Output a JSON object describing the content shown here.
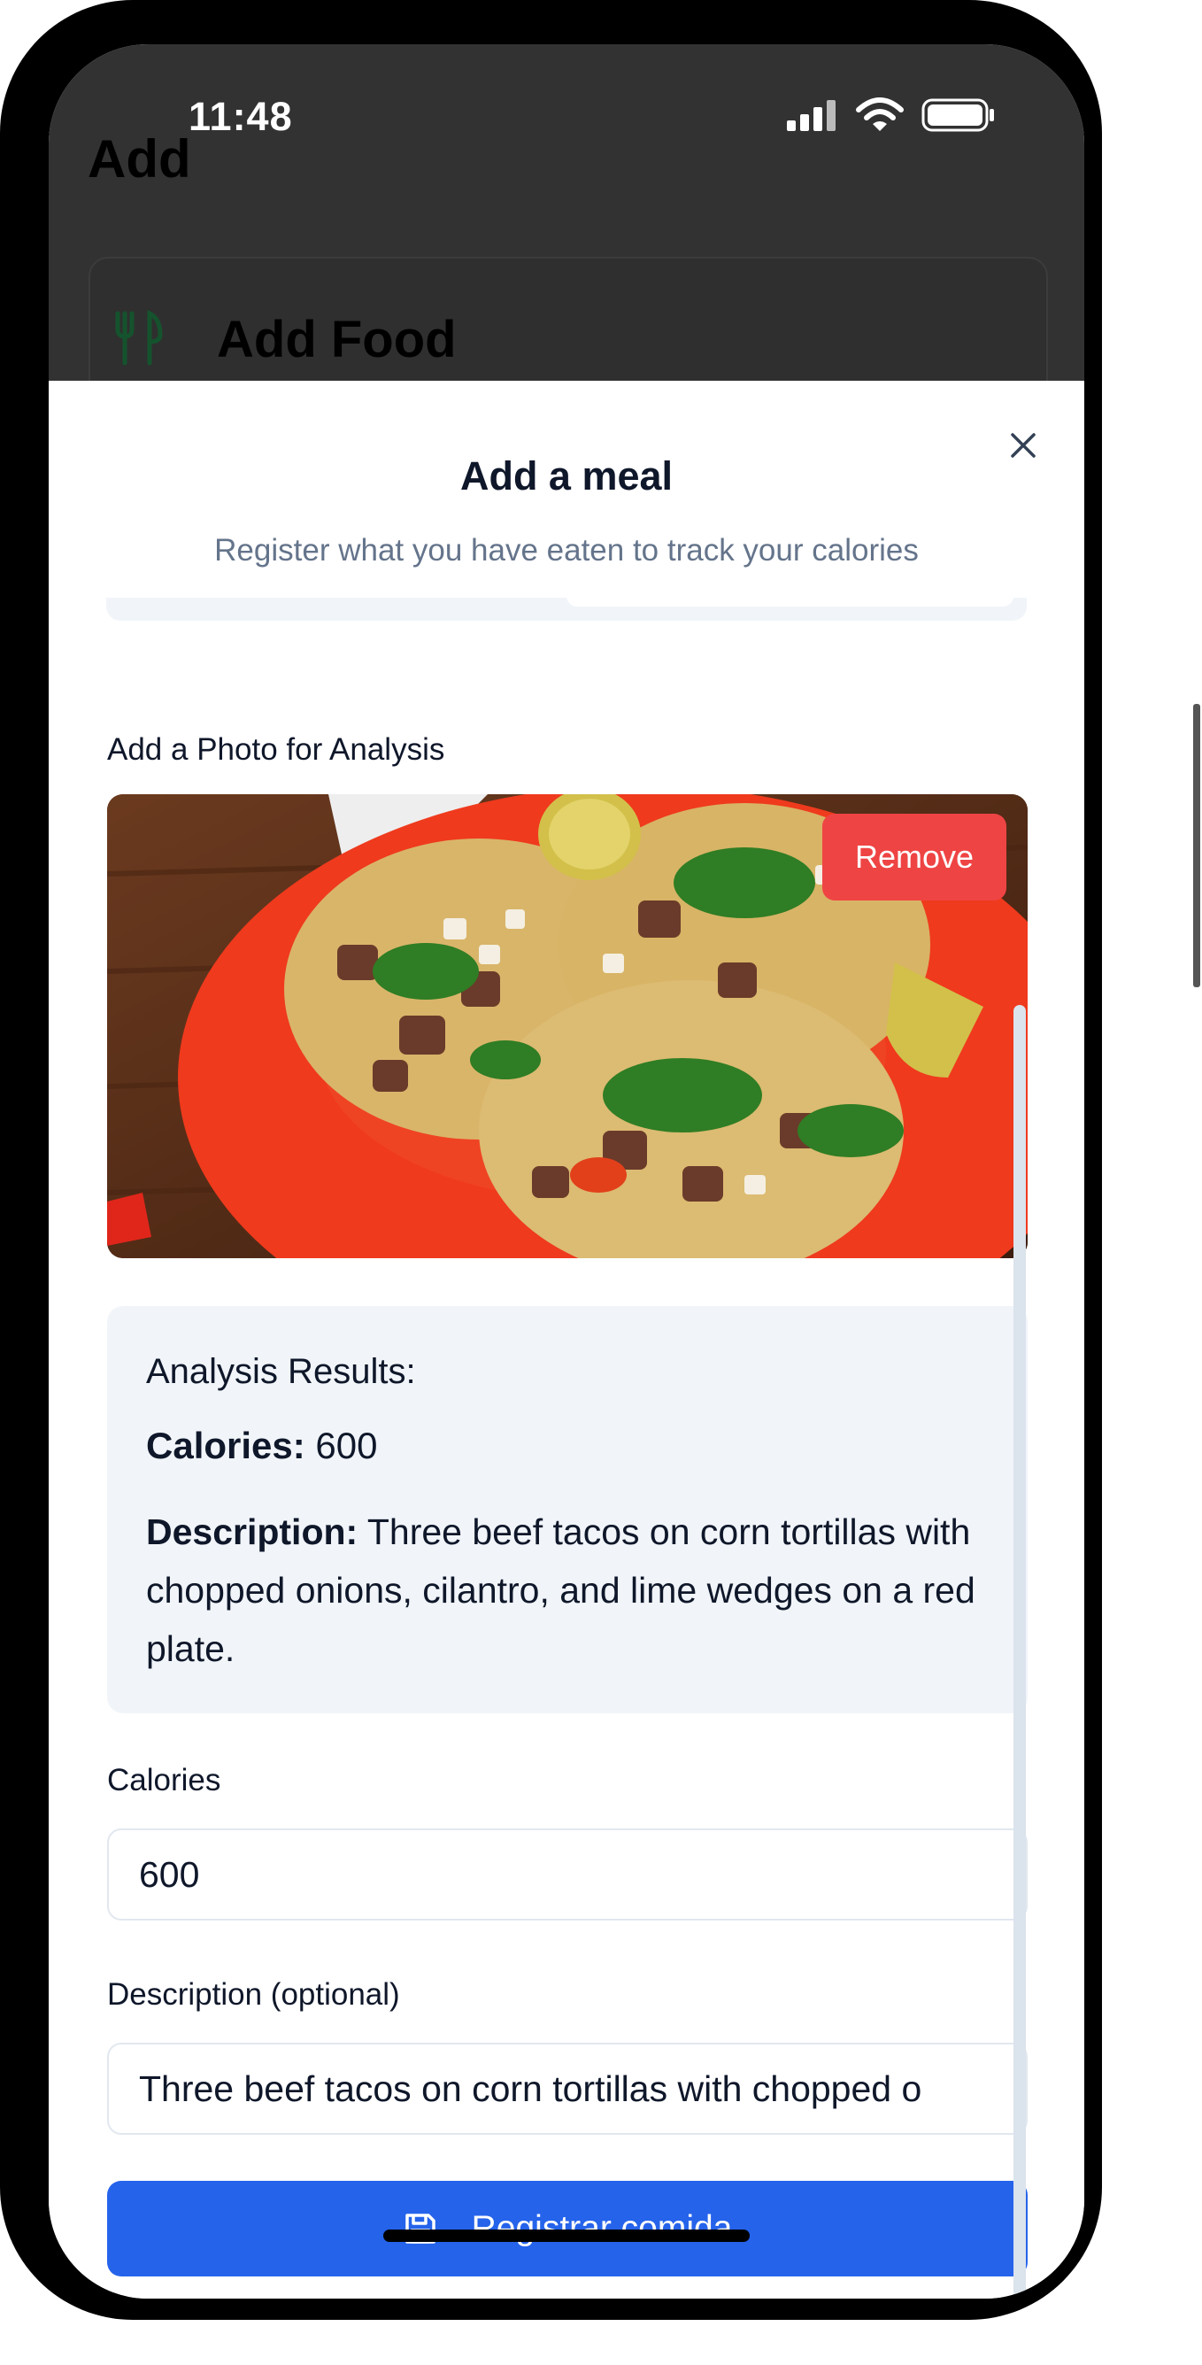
{
  "status_bar": {
    "time": "11:48"
  },
  "background": {
    "title": "Add",
    "card_title": "Add Food"
  },
  "dialog": {
    "title": "Add a meal",
    "subtitle": "Register what you have eaten to track your calories",
    "photo_label": "Add a Photo for Analysis",
    "remove_label": "Remove",
    "analysis": {
      "heading": "Analysis Results:",
      "calories_label": "Calories:",
      "calories_value": "600",
      "description_label": "Description:",
      "description_value": "Three beef tacos on corn tortillas with chopped onions, cilantro, and lime wedges on a red plate."
    },
    "calories_field": {
      "label": "Calories",
      "value": "600"
    },
    "description_field": {
      "label": "Description (optional)",
      "value": "Three beef tacos on corn tortillas with chopped o"
    },
    "submit_label": "Registrar comida"
  },
  "colors": {
    "primary": "#2563eb",
    "danger": "#ef4444",
    "muted_bg": "#f1f5f9",
    "text": "#0f172a",
    "muted_text": "#64748b",
    "food_icon": "#22c55e"
  }
}
